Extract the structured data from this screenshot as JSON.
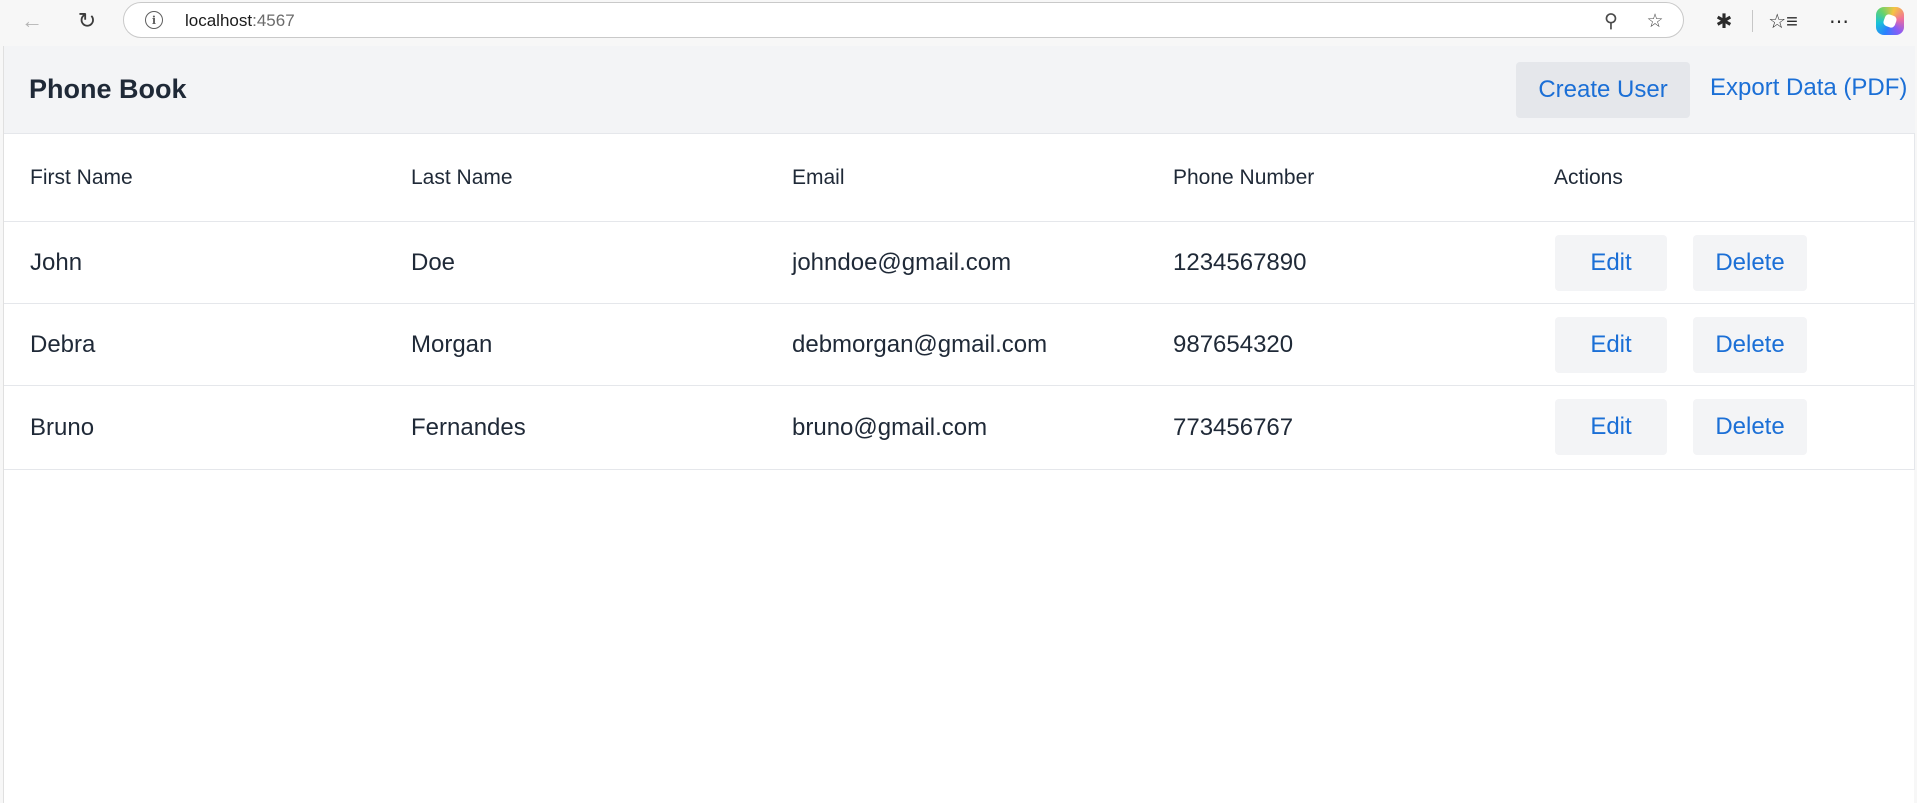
{
  "browser": {
    "url_host": "localhost",
    "url_port": ":4567"
  },
  "app": {
    "title": "Phone Book",
    "create_label": "Create User",
    "export_label": "Export Data (PDF)"
  },
  "table": {
    "headers": [
      "First Name",
      "Last Name",
      "Email",
      "Phone Number",
      "Actions"
    ],
    "edit_label": "Edit",
    "delete_label": "Delete",
    "rows": [
      [
        "John",
        "Doe",
        "johndoe@gmail.com",
        "1234567890"
      ],
      [
        "Debra",
        "Morgan",
        "debmorgan@gmail.com",
        "987654320"
      ],
      [
        "Bruno",
        "Fernandes",
        "bruno@gmail.com",
        "773456767"
      ]
    ]
  }
}
